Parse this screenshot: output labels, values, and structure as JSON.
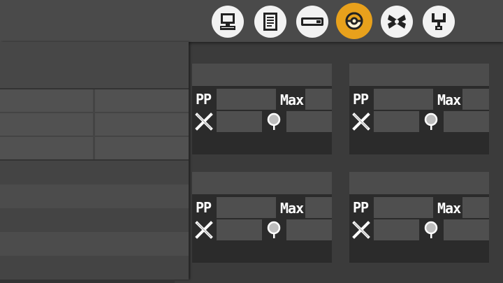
{
  "colors": {
    "active_tab": "#e8a11c",
    "tab_bg": "#f2f2f2",
    "panel_bg": "#2b2b2b",
    "field_bg": "#4f4f4f"
  },
  "tabs": [
    {
      "icon": "pc-icon",
      "active": false
    },
    {
      "icon": "document-icon",
      "active": false
    },
    {
      "icon": "bar-icon",
      "active": false
    },
    {
      "icon": "pokeball-icon",
      "active": true
    },
    {
      "icon": "ribbon-icon",
      "active": false
    },
    {
      "icon": "fork-icon",
      "active": false
    }
  ],
  "move_cards": [
    {
      "pp_label": "PP",
      "max_label": "Max"
    },
    {
      "pp_label": "PP",
      "max_label": "Max"
    },
    {
      "pp_label": "PP",
      "max_label": "Max"
    },
    {
      "pp_label": "PP",
      "max_label": "Max"
    }
  ]
}
